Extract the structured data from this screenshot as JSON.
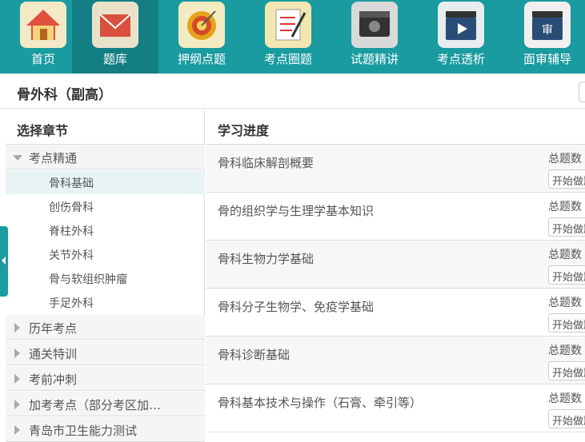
{
  "nav": {
    "items": [
      {
        "label": "首页",
        "icon": "home-icon"
      },
      {
        "label": "题库",
        "icon": "envelope-icon"
      },
      {
        "label": "押纲点题",
        "icon": "target-icon"
      },
      {
        "label": "考点圈题",
        "icon": "checklist-icon"
      },
      {
        "label": "试题精讲",
        "icon": "video-camera-icon"
      },
      {
        "label": "考点透析",
        "icon": "clapperboard-icon"
      },
      {
        "label": "面审辅导",
        "icon": "clapperboard-review-icon"
      }
    ],
    "active_index": 1,
    "bar_color": "#1a9ba0"
  },
  "page": {
    "title": "骨外科（副高）"
  },
  "left_panel": {
    "header": "选择章节",
    "groups": [
      {
        "label": "考点精通",
        "expanded": true,
        "children": [
          "骨科基础",
          "创伤骨科",
          "脊柱外科",
          "关节外科",
          "骨与软组织肿瘤",
          "手足外科"
        ],
        "active_child": 0
      },
      {
        "label": "历年考点",
        "expanded": false
      },
      {
        "label": "通关特训",
        "expanded": false
      },
      {
        "label": "考前冲刺",
        "expanded": false
      },
      {
        "label": "加考考点（部分考区加…",
        "expanded": false
      },
      {
        "label": "青岛市卫生能力测试",
        "expanded": false
      }
    ]
  },
  "right_panel": {
    "header": "学习进度",
    "total_label": "总题数",
    "start_label": "开始做题",
    "rows": [
      {
        "title": "骨科临床解剖概要"
      },
      {
        "title": "骨的组织学与生理学基本知识"
      },
      {
        "title": "骨科生物力学基础"
      },
      {
        "title": "骨科分子生物学、免疫学基础"
      },
      {
        "title": "骨科诊断基础"
      },
      {
        "title": "骨科基本技术与操作（石膏、牵引等）"
      }
    ]
  }
}
